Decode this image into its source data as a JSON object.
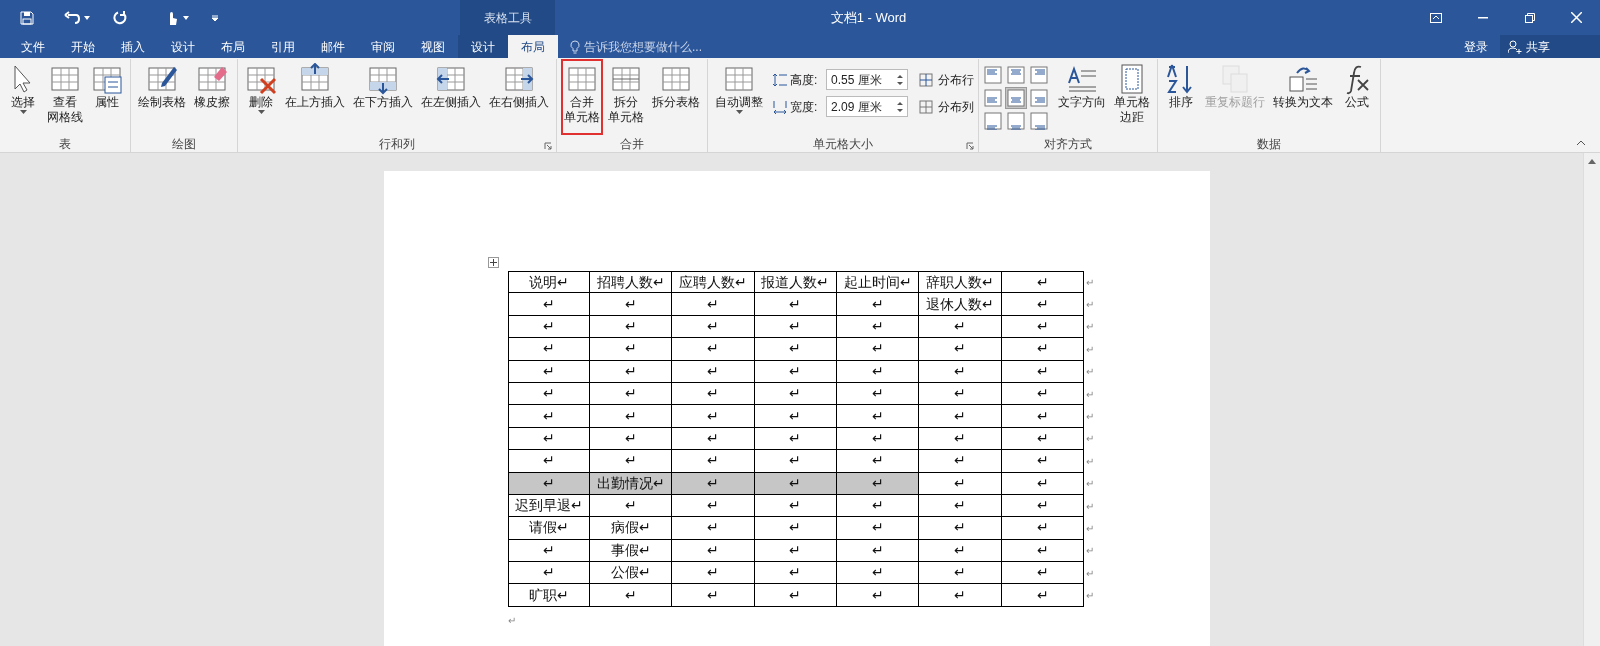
{
  "title_bar": {
    "contextual_tab": "表格工具",
    "title": "文档1 - Word"
  },
  "tabs": [
    {
      "label": "文件",
      "kind": "normal",
      "selected": false
    },
    {
      "label": "开始",
      "kind": "normal",
      "selected": false
    },
    {
      "label": "插入",
      "kind": "normal",
      "selected": false
    },
    {
      "label": "设计",
      "kind": "normal",
      "selected": false
    },
    {
      "label": "布局",
      "kind": "normal",
      "selected": false
    },
    {
      "label": "引用",
      "kind": "normal",
      "selected": false
    },
    {
      "label": "邮件",
      "kind": "normal",
      "selected": false
    },
    {
      "label": "审阅",
      "kind": "normal",
      "selected": false
    },
    {
      "label": "视图",
      "kind": "normal",
      "selected": false
    },
    {
      "label": "设计",
      "kind": "contextual",
      "selected": false
    },
    {
      "label": "布局",
      "kind": "contextual",
      "selected": true
    }
  ],
  "tell_me": {
    "placeholder": "告诉我您想要做什么..."
  },
  "account": {
    "sign_in": "登录",
    "share": "共享"
  },
  "ribbon_groups": [
    {
      "label": "表",
      "kind": "buttons",
      "launcher": false,
      "buttons": [
        {
          "lines": [
            "选择"
          ],
          "dropdown": true,
          "disabled": false,
          "highlighted": false
        },
        {
          "lines": [
            "查看",
            "网格线"
          ],
          "dropdown": false,
          "disabled": false,
          "highlighted": false
        },
        {
          "lines": [
            "属性"
          ],
          "dropdown": false,
          "disabled": false,
          "highlighted": false
        }
      ]
    },
    {
      "label": "绘图",
      "kind": "buttons",
      "launcher": false,
      "buttons": [
        {
          "lines": [
            "绘制表格"
          ],
          "dropdown": false,
          "disabled": false,
          "highlighted": false
        },
        {
          "lines": [
            "橡皮擦"
          ],
          "dropdown": false,
          "disabled": false,
          "highlighted": false
        }
      ]
    },
    {
      "label": "行和列",
      "kind": "buttons",
      "launcher": true,
      "buttons": [
        {
          "lines": [
            "删除"
          ],
          "dropdown": true,
          "disabled": false,
          "highlighted": false
        },
        {
          "lines": [
            "在上方插入"
          ],
          "dropdown": false,
          "disabled": false,
          "highlighted": false
        },
        {
          "lines": [
            "在下方插入"
          ],
          "dropdown": false,
          "disabled": false,
          "highlighted": false
        },
        {
          "lines": [
            "在左侧插入"
          ],
          "dropdown": false,
          "disabled": false,
          "highlighted": false
        },
        {
          "lines": [
            "在右侧插入"
          ],
          "dropdown": false,
          "disabled": false,
          "highlighted": false
        }
      ]
    },
    {
      "label": "合并",
      "kind": "buttons",
      "launcher": false,
      "buttons": [
        {
          "lines": [
            "合并",
            "单元格"
          ],
          "dropdown": false,
          "disabled": false,
          "highlighted": true
        },
        {
          "lines": [
            "拆分",
            "单元格"
          ],
          "dropdown": false,
          "disabled": false,
          "highlighted": false
        },
        {
          "lines": [
            "拆分表格"
          ],
          "dropdown": false,
          "disabled": false,
          "highlighted": false
        }
      ]
    },
    {
      "label": "单元格大小",
      "kind": "size",
      "launcher": true,
      "buttons": [
        {
          "lines": [
            "自动调整"
          ],
          "dropdown": true,
          "disabled": false,
          "highlighted": false
        }
      ],
      "fields": [
        {
          "label": "高度:",
          "value": "0.55 厘米"
        },
        {
          "label": "宽度:",
          "value": "2.09 厘米"
        }
      ],
      "distribute": [
        {
          "label": "分布行"
        },
        {
          "label": "分布列"
        }
      ]
    },
    {
      "label": "对齐方式",
      "kind": "align",
      "launcher": false,
      "align": [
        {
          "selected": false
        },
        {
          "selected": false
        },
        {
          "selected": false
        },
        {
          "selected": false
        },
        {
          "selected": true
        },
        {
          "selected": false
        },
        {
          "selected": false
        },
        {
          "selected": false
        },
        {
          "selected": false
        }
      ],
      "buttons": [
        {
          "lines": [
            "文字方向"
          ],
          "dropdown": false,
          "disabled": false,
          "highlighted": false
        },
        {
          "lines": [
            "单元格",
            "边距"
          ],
          "dropdown": false,
          "disabled": false,
          "highlighted": false
        }
      ]
    },
    {
      "label": "数据",
      "kind": "buttons",
      "launcher": false,
      "buttons": [
        {
          "lines": [
            "排序"
          ],
          "dropdown": false,
          "disabled": false,
          "highlighted": false
        },
        {
          "lines": [
            "重复标题行"
          ],
          "dropdown": false,
          "disabled": true,
          "highlighted": false
        },
        {
          "lines": [
            "转换为文本"
          ],
          "dropdown": false,
          "disabled": false,
          "highlighted": false
        },
        {
          "lines": [
            "公式"
          ],
          "dropdown": false,
          "disabled": false,
          "highlighted": false
        }
      ]
    }
  ],
  "document": {
    "after_table_mark": "↵",
    "table": {
      "rows": [
        {
          "end_mark": "↵",
          "cells": [
            {
              "text": "说明↵",
              "selected": false
            },
            {
              "text": "招聘人数↵",
              "selected": false
            },
            {
              "text": "应聘人数↵",
              "selected": false
            },
            {
              "text": "报道人数↵",
              "selected": false
            },
            {
              "text": "起止时间↵",
              "selected": false
            },
            {
              "text": "辞职人数↵",
              "selected": false
            },
            {
              "text": "↵",
              "selected": false
            }
          ]
        },
        {
          "end_mark": "↵",
          "cells": [
            {
              "text": "↵",
              "selected": false
            },
            {
              "text": "↵",
              "selected": false
            },
            {
              "text": "↵",
              "selected": false
            },
            {
              "text": "↵",
              "selected": false
            },
            {
              "text": "↵",
              "selected": false
            },
            {
              "text": "退休人数↵",
              "selected": false
            },
            {
              "text": "↵",
              "selected": false
            }
          ]
        },
        {
          "end_mark": "↵",
          "cells": [
            {
              "text": "↵",
              "selected": false
            },
            {
              "text": "↵",
              "selected": false
            },
            {
              "text": "↵",
              "selected": false
            },
            {
              "text": "↵",
              "selected": false
            },
            {
              "text": "↵",
              "selected": false
            },
            {
              "text": "↵",
              "selected": false
            },
            {
              "text": "↵",
              "selected": false
            }
          ]
        },
        {
          "end_mark": "↵",
          "cells": [
            {
              "text": "↵",
              "selected": false
            },
            {
              "text": "↵",
              "selected": false
            },
            {
              "text": "↵",
              "selected": false
            },
            {
              "text": "↵",
              "selected": false
            },
            {
              "text": "↵",
              "selected": false
            },
            {
              "text": "↵",
              "selected": false
            },
            {
              "text": "↵",
              "selected": false
            }
          ]
        },
        {
          "end_mark": "↵",
          "cells": [
            {
              "text": "↵",
              "selected": false
            },
            {
              "text": "↵",
              "selected": false
            },
            {
              "text": "↵",
              "selected": false
            },
            {
              "text": "↵",
              "selected": false
            },
            {
              "text": "↵",
              "selected": false
            },
            {
              "text": "↵",
              "selected": false
            },
            {
              "text": "↵",
              "selected": false
            }
          ]
        },
        {
          "end_mark": "↵",
          "cells": [
            {
              "text": "↵",
              "selected": false
            },
            {
              "text": "↵",
              "selected": false
            },
            {
              "text": "↵",
              "selected": false
            },
            {
              "text": "↵",
              "selected": false
            },
            {
              "text": "↵",
              "selected": false
            },
            {
              "text": "↵",
              "selected": false
            },
            {
              "text": "↵",
              "selected": false
            }
          ]
        },
        {
          "end_mark": "↵",
          "cells": [
            {
              "text": "↵",
              "selected": false
            },
            {
              "text": "↵",
              "selected": false
            },
            {
              "text": "↵",
              "selected": false
            },
            {
              "text": "↵",
              "selected": false
            },
            {
              "text": "↵",
              "selected": false
            },
            {
              "text": "↵",
              "selected": false
            },
            {
              "text": "↵",
              "selected": false
            }
          ]
        },
        {
          "end_mark": "↵",
          "cells": [
            {
              "text": "↵",
              "selected": false
            },
            {
              "text": "↵",
              "selected": false
            },
            {
              "text": "↵",
              "selected": false
            },
            {
              "text": "↵",
              "selected": false
            },
            {
              "text": "↵",
              "selected": false
            },
            {
              "text": "↵",
              "selected": false
            },
            {
              "text": "↵",
              "selected": false
            }
          ]
        },
        {
          "end_mark": "↵",
          "cells": [
            {
              "text": "↵",
              "selected": false
            },
            {
              "text": "↵",
              "selected": false
            },
            {
              "text": "↵",
              "selected": false
            },
            {
              "text": "↵",
              "selected": false
            },
            {
              "text": "↵",
              "selected": false
            },
            {
              "text": "↵",
              "selected": false
            },
            {
              "text": "↵",
              "selected": false
            }
          ]
        },
        {
          "end_mark": "↵",
          "cells": [
            {
              "text": "↵",
              "selected": true
            },
            {
              "text": "出勤情况↵",
              "selected": true
            },
            {
              "text": "↵",
              "selected": true
            },
            {
              "text": "↵",
              "selected": true
            },
            {
              "text": "↵",
              "selected": true
            },
            {
              "text": "↵",
              "selected": false
            },
            {
              "text": "↵",
              "selected": false
            }
          ]
        },
        {
          "end_mark": "↵",
          "cells": [
            {
              "text": "迟到早退↵",
              "selected": false
            },
            {
              "text": "↵",
              "selected": false
            },
            {
              "text": "↵",
              "selected": false
            },
            {
              "text": "↵",
              "selected": false
            },
            {
              "text": "↵",
              "selected": false
            },
            {
              "text": "↵",
              "selected": false
            },
            {
              "text": "↵",
              "selected": false
            }
          ]
        },
        {
          "end_mark": "↵",
          "cells": [
            {
              "text": "请假↵",
              "selected": false
            },
            {
              "text": "病假↵",
              "selected": false
            },
            {
              "text": "↵",
              "selected": false
            },
            {
              "text": "↵",
              "selected": false
            },
            {
              "text": "↵",
              "selected": false
            },
            {
              "text": "↵",
              "selected": false
            },
            {
              "text": "↵",
              "selected": false
            }
          ]
        },
        {
          "end_mark": "↵",
          "cells": [
            {
              "text": "↵",
              "selected": false
            },
            {
              "text": "事假↵",
              "selected": false
            },
            {
              "text": "↵",
              "selected": false
            },
            {
              "text": "↵",
              "selected": false
            },
            {
              "text": "↵",
              "selected": false
            },
            {
              "text": "↵",
              "selected": false
            },
            {
              "text": "↵",
              "selected": false
            }
          ]
        },
        {
          "end_mark": "↵",
          "cells": [
            {
              "text": "↵",
              "selected": false
            },
            {
              "text": "公假↵",
              "selected": false
            },
            {
              "text": "↵",
              "selected": false
            },
            {
              "text": "↵",
              "selected": false
            },
            {
              "text": "↵",
              "selected": false
            },
            {
              "text": "↵",
              "selected": false
            },
            {
              "text": "↵",
              "selected": false
            }
          ]
        },
        {
          "end_mark": "↵",
          "cells": [
            {
              "text": "旷职↵",
              "selected": false
            },
            {
              "text": "↵",
              "selected": false
            },
            {
              "text": "↵",
              "selected": false
            },
            {
              "text": "↵",
              "selected": false
            },
            {
              "text": "↵",
              "selected": false
            },
            {
              "text": "↵",
              "selected": false
            },
            {
              "text": "↵",
              "selected": false
            }
          ]
        }
      ]
    }
  }
}
